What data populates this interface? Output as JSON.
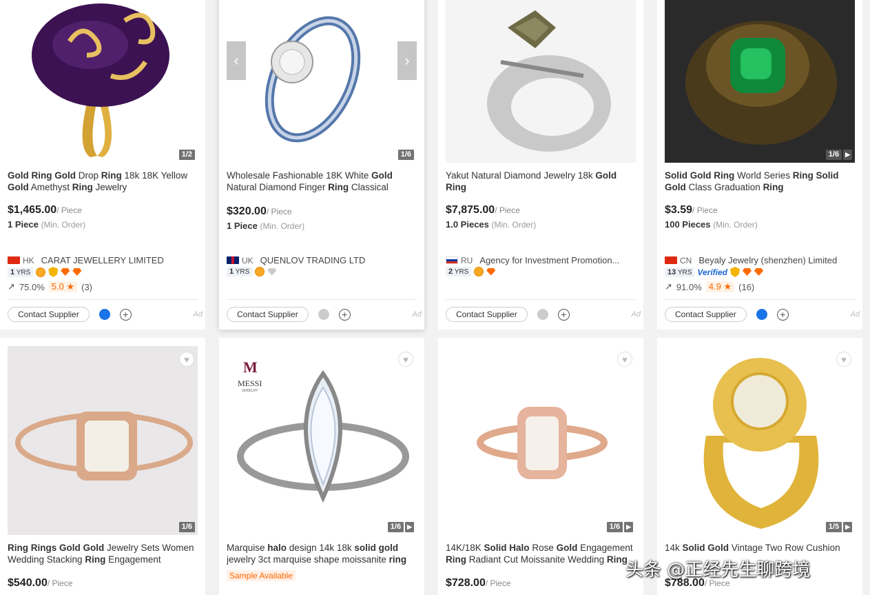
{
  "products": [
    {
      "pager": "1/2",
      "title_segments": [
        [
          "Gold",
          true
        ],
        [
          " ",
          false
        ],
        [
          "Ring",
          true
        ],
        [
          " ",
          false
        ],
        [
          "Gold",
          true
        ],
        [
          " Drop ",
          false
        ],
        [
          "Ring",
          true
        ],
        [
          " 18k 18K Yellow ",
          false
        ],
        [
          "Gold",
          true
        ],
        [
          " Amethyst ",
          false
        ],
        [
          "Ring",
          true
        ],
        [
          " Jewelry",
          false
        ]
      ],
      "price": "$1,465.00",
      "unit": "/ Piece",
      "moq": "1 Piece",
      "moq_note": "(Min. Order)",
      "country": "HK",
      "supplier": "CARAT JEWELLERY LIMITED",
      "years": "1",
      "years_suffix": "YRS",
      "response_rate": "75.0%",
      "rating": "5.0 ★",
      "reviews": "(3)",
      "contact_label": "Contact Supplier",
      "ad": "Ad"
    },
    {
      "pager": "1/6",
      "prev": "‹",
      "next": "›",
      "title_segments": [
        [
          "Wholesale Fashionable 18K White ",
          false
        ],
        [
          "Gold",
          true
        ],
        [
          " Natural Diamond Finger ",
          false
        ],
        [
          "Ring",
          true
        ],
        [
          " Classical",
          false
        ]
      ],
      "price": "$320.00",
      "unit": "/ Piece",
      "moq": "1 Piece",
      "moq_note": "(Min. Order)",
      "country": "UK",
      "supplier": "QUENLOV TRADING LTD",
      "years": "1",
      "years_suffix": "YRS",
      "contact_label": "Contact Supplier",
      "ad": "Ad"
    },
    {
      "title_segments": [
        [
          "Yakut Natural Diamond Jewelry 18k ",
          false
        ],
        [
          "Gold",
          true
        ],
        [
          " ",
          false
        ],
        [
          "Ring",
          true
        ]
      ],
      "price": "$7,875.00",
      "unit": "/ Piece",
      "moq": "1.0 Pieces",
      "moq_note": "(Min. Order)",
      "country": "RU",
      "supplier": "Agency for Investment Promotion...",
      "years": "2",
      "years_suffix": "YRS",
      "contact_label": "Contact Supplier",
      "ad": "Ad"
    },
    {
      "pager": "1/6",
      "title_segments": [
        [
          "Solid Gold Ring",
          true
        ],
        [
          " World Series ",
          false
        ],
        [
          "Ring Solid Gold",
          true
        ],
        [
          " Class Graduation ",
          false
        ],
        [
          "Ring",
          true
        ]
      ],
      "price": "$3.59",
      "unit": "/ Piece",
      "moq": "100 Pieces",
      "moq_note": "(Min. Order)",
      "country": "CN",
      "supplier": "Beyaly Jewelry (shenzhen) Limited",
      "years": "13",
      "years_suffix": "YRS",
      "verified": "Verified",
      "response_rate": "91.0%",
      "rating": "4.9 ★",
      "reviews": "(16)",
      "contact_label": "Contact Supplier",
      "ad": "Ad"
    },
    {
      "pager": "1/6",
      "title_segments": [
        [
          "Ring Rings Gold Gold",
          true
        ],
        [
          " Jewelry Sets Women Wedding Stacking ",
          false
        ],
        [
          "Ring",
          true
        ],
        [
          " Engagement",
          false
        ]
      ],
      "price": "$540.00",
      "unit": "/ Piece"
    },
    {
      "pager": "1/6",
      "logo": "MESSI",
      "logo_sub": "JEWELRY",
      "title_segments": [
        [
          "Marquise ",
          false
        ],
        [
          "halo",
          true
        ],
        [
          " design 14k 18k ",
          false
        ],
        [
          "solid gold",
          true
        ],
        [
          " jewelry 3ct marquise shape moissanite ",
          false
        ],
        [
          "ring",
          true
        ]
      ],
      "sample": "Sample Available"
    },
    {
      "pager": "1/6",
      "title_segments": [
        [
          "14K/18K ",
          false
        ],
        [
          "Solid Halo",
          true
        ],
        [
          " Rose ",
          false
        ],
        [
          "Gold",
          true
        ],
        [
          " Engagement ",
          false
        ],
        [
          "Ring",
          true
        ],
        [
          " Radiant Cut Moissanite Wedding ",
          false
        ],
        [
          "Ring",
          true
        ]
      ],
      "price": "$728.00",
      "unit": "/ Piece"
    },
    {
      "pager": "1/5",
      "title_segments": [
        [
          "14k ",
          false
        ],
        [
          "Solid Gold",
          true
        ],
        [
          " Vintage Two Row Cushion",
          false
        ]
      ],
      "price": "$788.00",
      "unit": "/ Piece"
    }
  ],
  "watermark": "头条 @正经先生聊跨境",
  "icons": [
    "heart-icon",
    "play-icon",
    "chat-icon",
    "add-compare-icon",
    "flag-icon",
    "medal-icon",
    "diamond-icon"
  ]
}
